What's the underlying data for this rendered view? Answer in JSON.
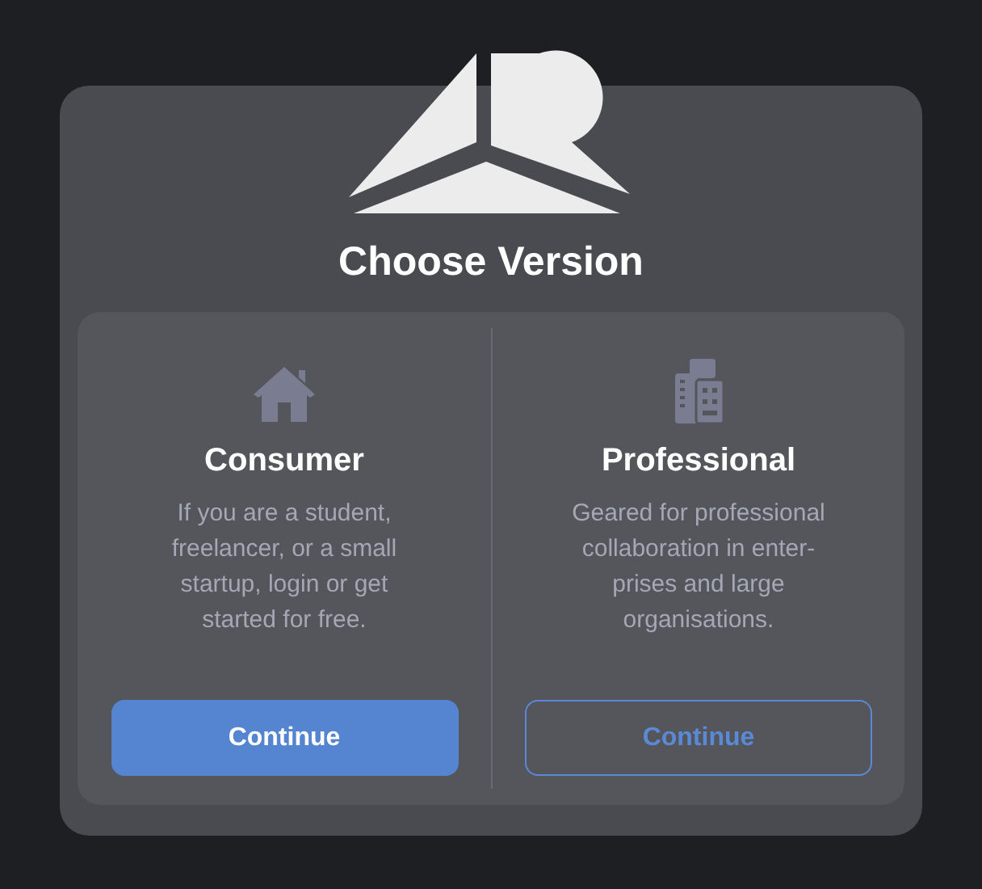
{
  "title": "Choose Version",
  "options": [
    {
      "kind": "house",
      "name": "Consumer",
      "description": [
        "If you are a student,",
        "freelancer, or a small",
        "startup, login or get",
        "started for free."
      ],
      "button": {
        "label": "Continue",
        "kind": "primary"
      }
    },
    {
      "kind": "buildings",
      "name": "Professional",
      "description": [
        "Geared for professional",
        "collaboration in enter-",
        "prises and large",
        "organisations."
      ],
      "button": {
        "label": "Continue",
        "kind": "outline"
      }
    }
  ]
}
